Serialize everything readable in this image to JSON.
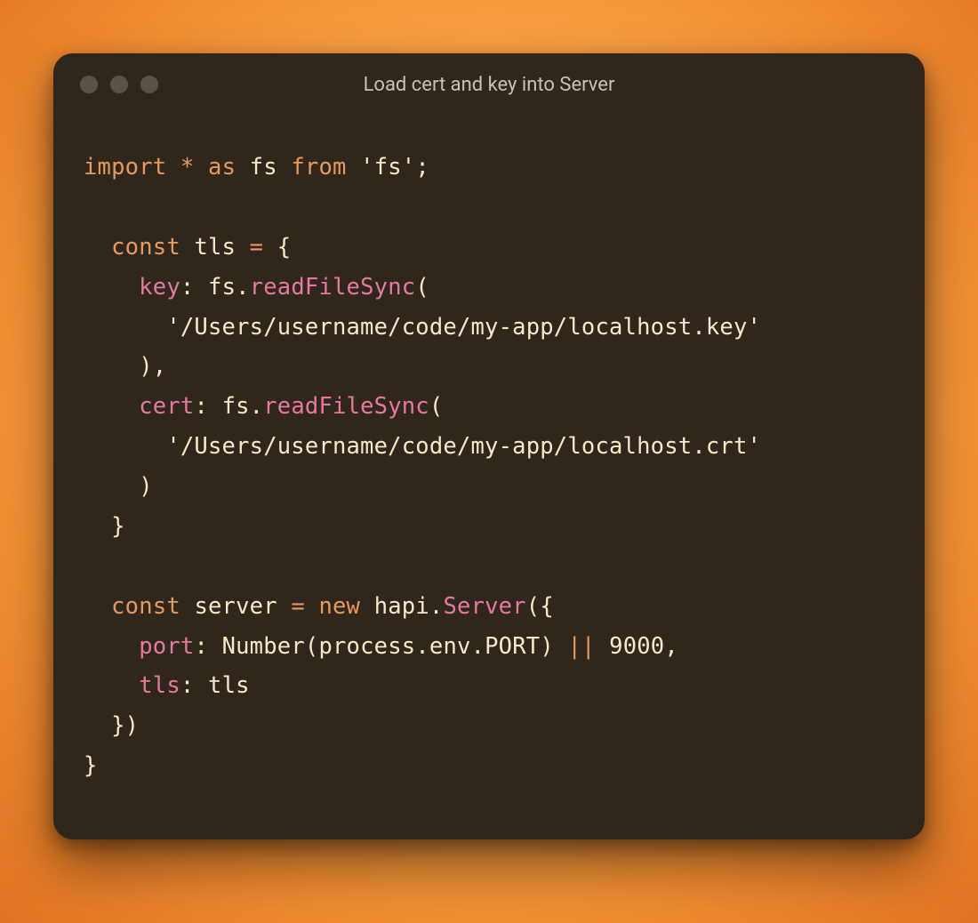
{
  "window": {
    "title": "Load cert and key into Server"
  },
  "code": {
    "kw_import": "import",
    "star": "*",
    "kw_as": "as",
    "id_fs": "fs",
    "kw_from": "from",
    "str_fs_mod": "'fs'",
    "semi": ";",
    "kw_const": "const",
    "id_tls": "tls",
    "eq": "=",
    "lbrace": "{",
    "rbrace": "}",
    "lparen": "(",
    "rparen": ")",
    "comma": ",",
    "colon": ":",
    "dot": ".",
    "prop_key": "key",
    "fn_readFileSync": "readFileSync",
    "str_key_path": "'/Users/username/code/my-app/localhost.key'",
    "prop_cert": "cert",
    "str_cert_path": "'/Users/username/code/my-app/localhost.crt'",
    "id_server": "server",
    "kw_new": "new",
    "id_hapi": "hapi",
    "cls_Server": "Server",
    "prop_port": "port",
    "id_Number": "Number",
    "id_process": "process",
    "id_env": "env",
    "id_PORT": "PORT",
    "op_or": "||",
    "num_9000": "9000",
    "prop_tls": "tls"
  }
}
